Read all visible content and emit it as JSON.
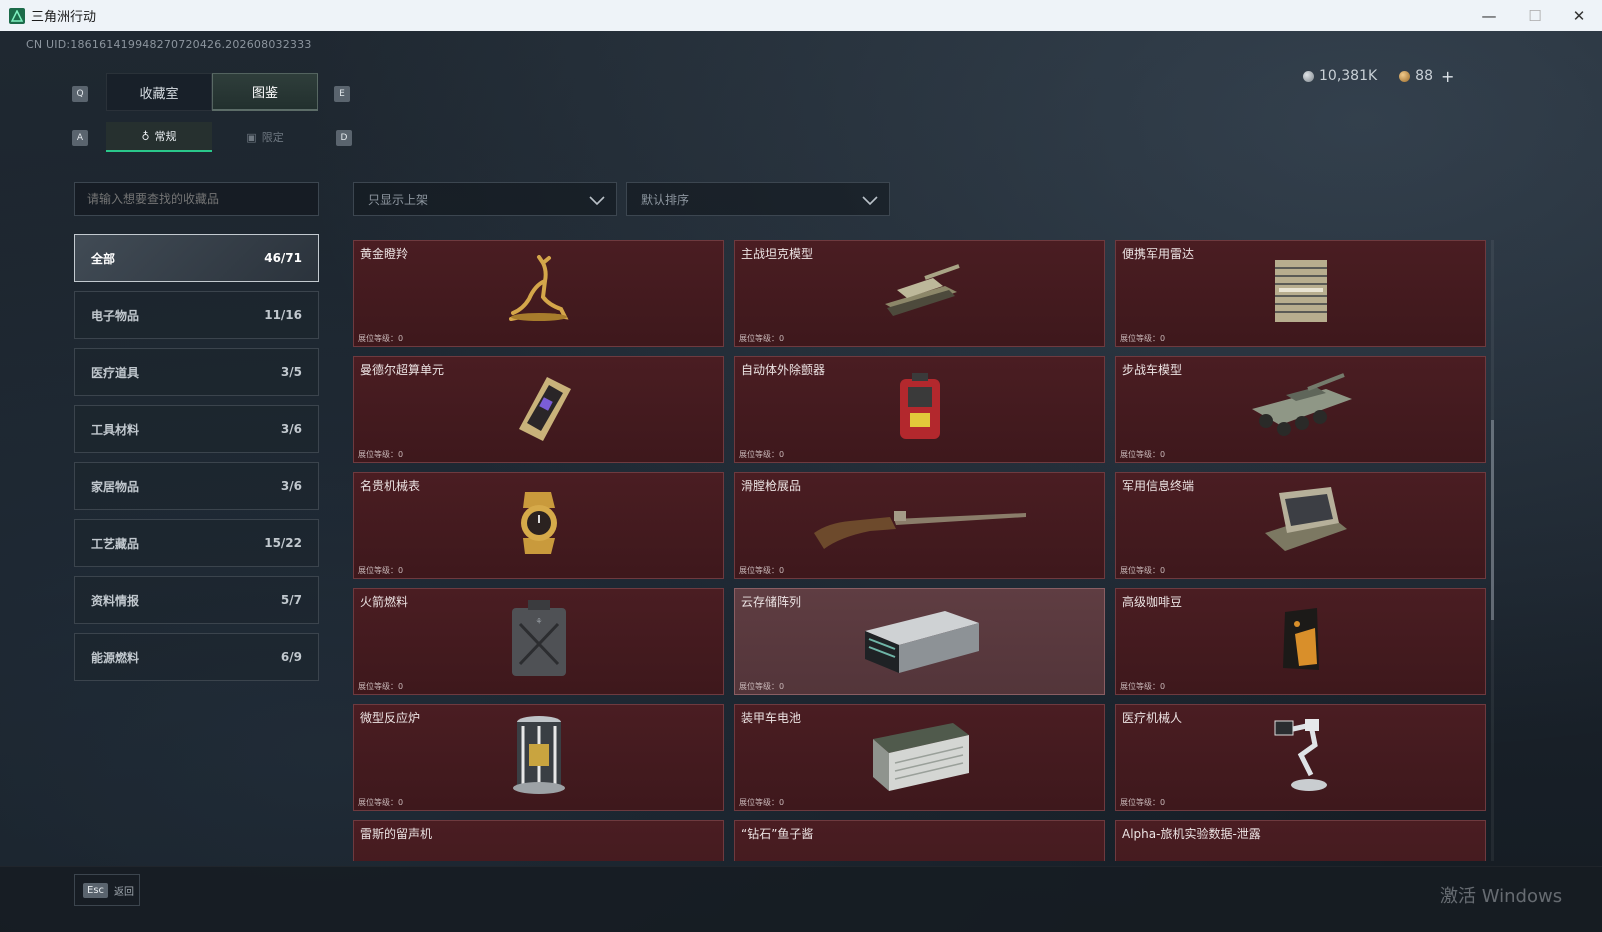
{
  "window": {
    "title": "三角洲行动",
    "minimize": "—",
    "maximize": "☐",
    "close": "✕"
  },
  "uid": "CN UID:18616141994827072042​6.202608032333",
  "currency": {
    "silver": "10,381K",
    "gold": "88",
    "add": "+"
  },
  "keys": {
    "q": "Q",
    "e": "E",
    "a": "A",
    "d": "D"
  },
  "tabs": [
    {
      "label": "收藏室",
      "active": false
    },
    {
      "label": "图鉴",
      "active": true
    }
  ],
  "subtabs": [
    {
      "label": "常规",
      "icon": "♁",
      "active": true
    },
    {
      "label": "限定",
      "icon": "▣",
      "active": false
    }
  ],
  "search": {
    "placeholder": "请输入想要查找的收藏品"
  },
  "filters": {
    "shelf": "只显示上架",
    "sort": "默认排序"
  },
  "categories": [
    {
      "label": "全部",
      "count": "46/71"
    },
    {
      "label": "电子物品",
      "count": "11/16"
    },
    {
      "label": "医疗道具",
      "count": "3/5"
    },
    {
      "label": "工具材料",
      "count": "3/6"
    },
    {
      "label": "家居物品",
      "count": "3/6"
    },
    {
      "label": "工艺藏品",
      "count": "15/22"
    },
    {
      "label": "资料情报",
      "count": "5/7"
    },
    {
      "label": "能源燃料",
      "count": "6/9"
    }
  ],
  "level_label": "展位等级：0",
  "items": [
    {
      "name": "黄金瞪羚",
      "icon": "gold-gazelle-icon"
    },
    {
      "name": "主战坦克模型",
      "icon": "tank-model-icon"
    },
    {
      "name": "便携军用雷达",
      "icon": "radar-icon"
    },
    {
      "name": "曼德尔超算单元",
      "icon": "supercomputer-chip-icon"
    },
    {
      "name": "自动体外除颤器",
      "icon": "defibrillator-icon"
    },
    {
      "name": "步战车模型",
      "icon": "ifv-model-icon"
    },
    {
      "name": "名贵机械表",
      "icon": "watch-icon"
    },
    {
      "name": "滑膛枪展品",
      "icon": "musket-icon"
    },
    {
      "name": "军用信息终端",
      "icon": "terminal-icon"
    },
    {
      "name": "火箭燃料",
      "icon": "fuel-can-icon"
    },
    {
      "name": "云存储阵列",
      "icon": "storage-array-icon"
    },
    {
      "name": "高级咖啡豆",
      "icon": "coffee-bag-icon"
    },
    {
      "name": "微型反应炉",
      "icon": "reactor-icon"
    },
    {
      "name": "装甲车电池",
      "icon": "battery-icon"
    },
    {
      "name": "医疗机械人",
      "icon": "medical-robot-icon"
    },
    {
      "name": "雷斯的留声机",
      "icon": "gramophone-icon"
    },
    {
      "name": "“钻石”鱼子酱",
      "icon": "caviar-icon"
    },
    {
      "name": "Alpha-旅机实验数据-泄露",
      "icon": "data-icon"
    }
  ],
  "back": {
    "key": "Esc",
    "label": "返回"
  },
  "watermark": "激活 Windows",
  "colors": {
    "accent": "#2ac78b",
    "card_bg": "#4a1d22",
    "card_highlight": "#5f3d42"
  }
}
